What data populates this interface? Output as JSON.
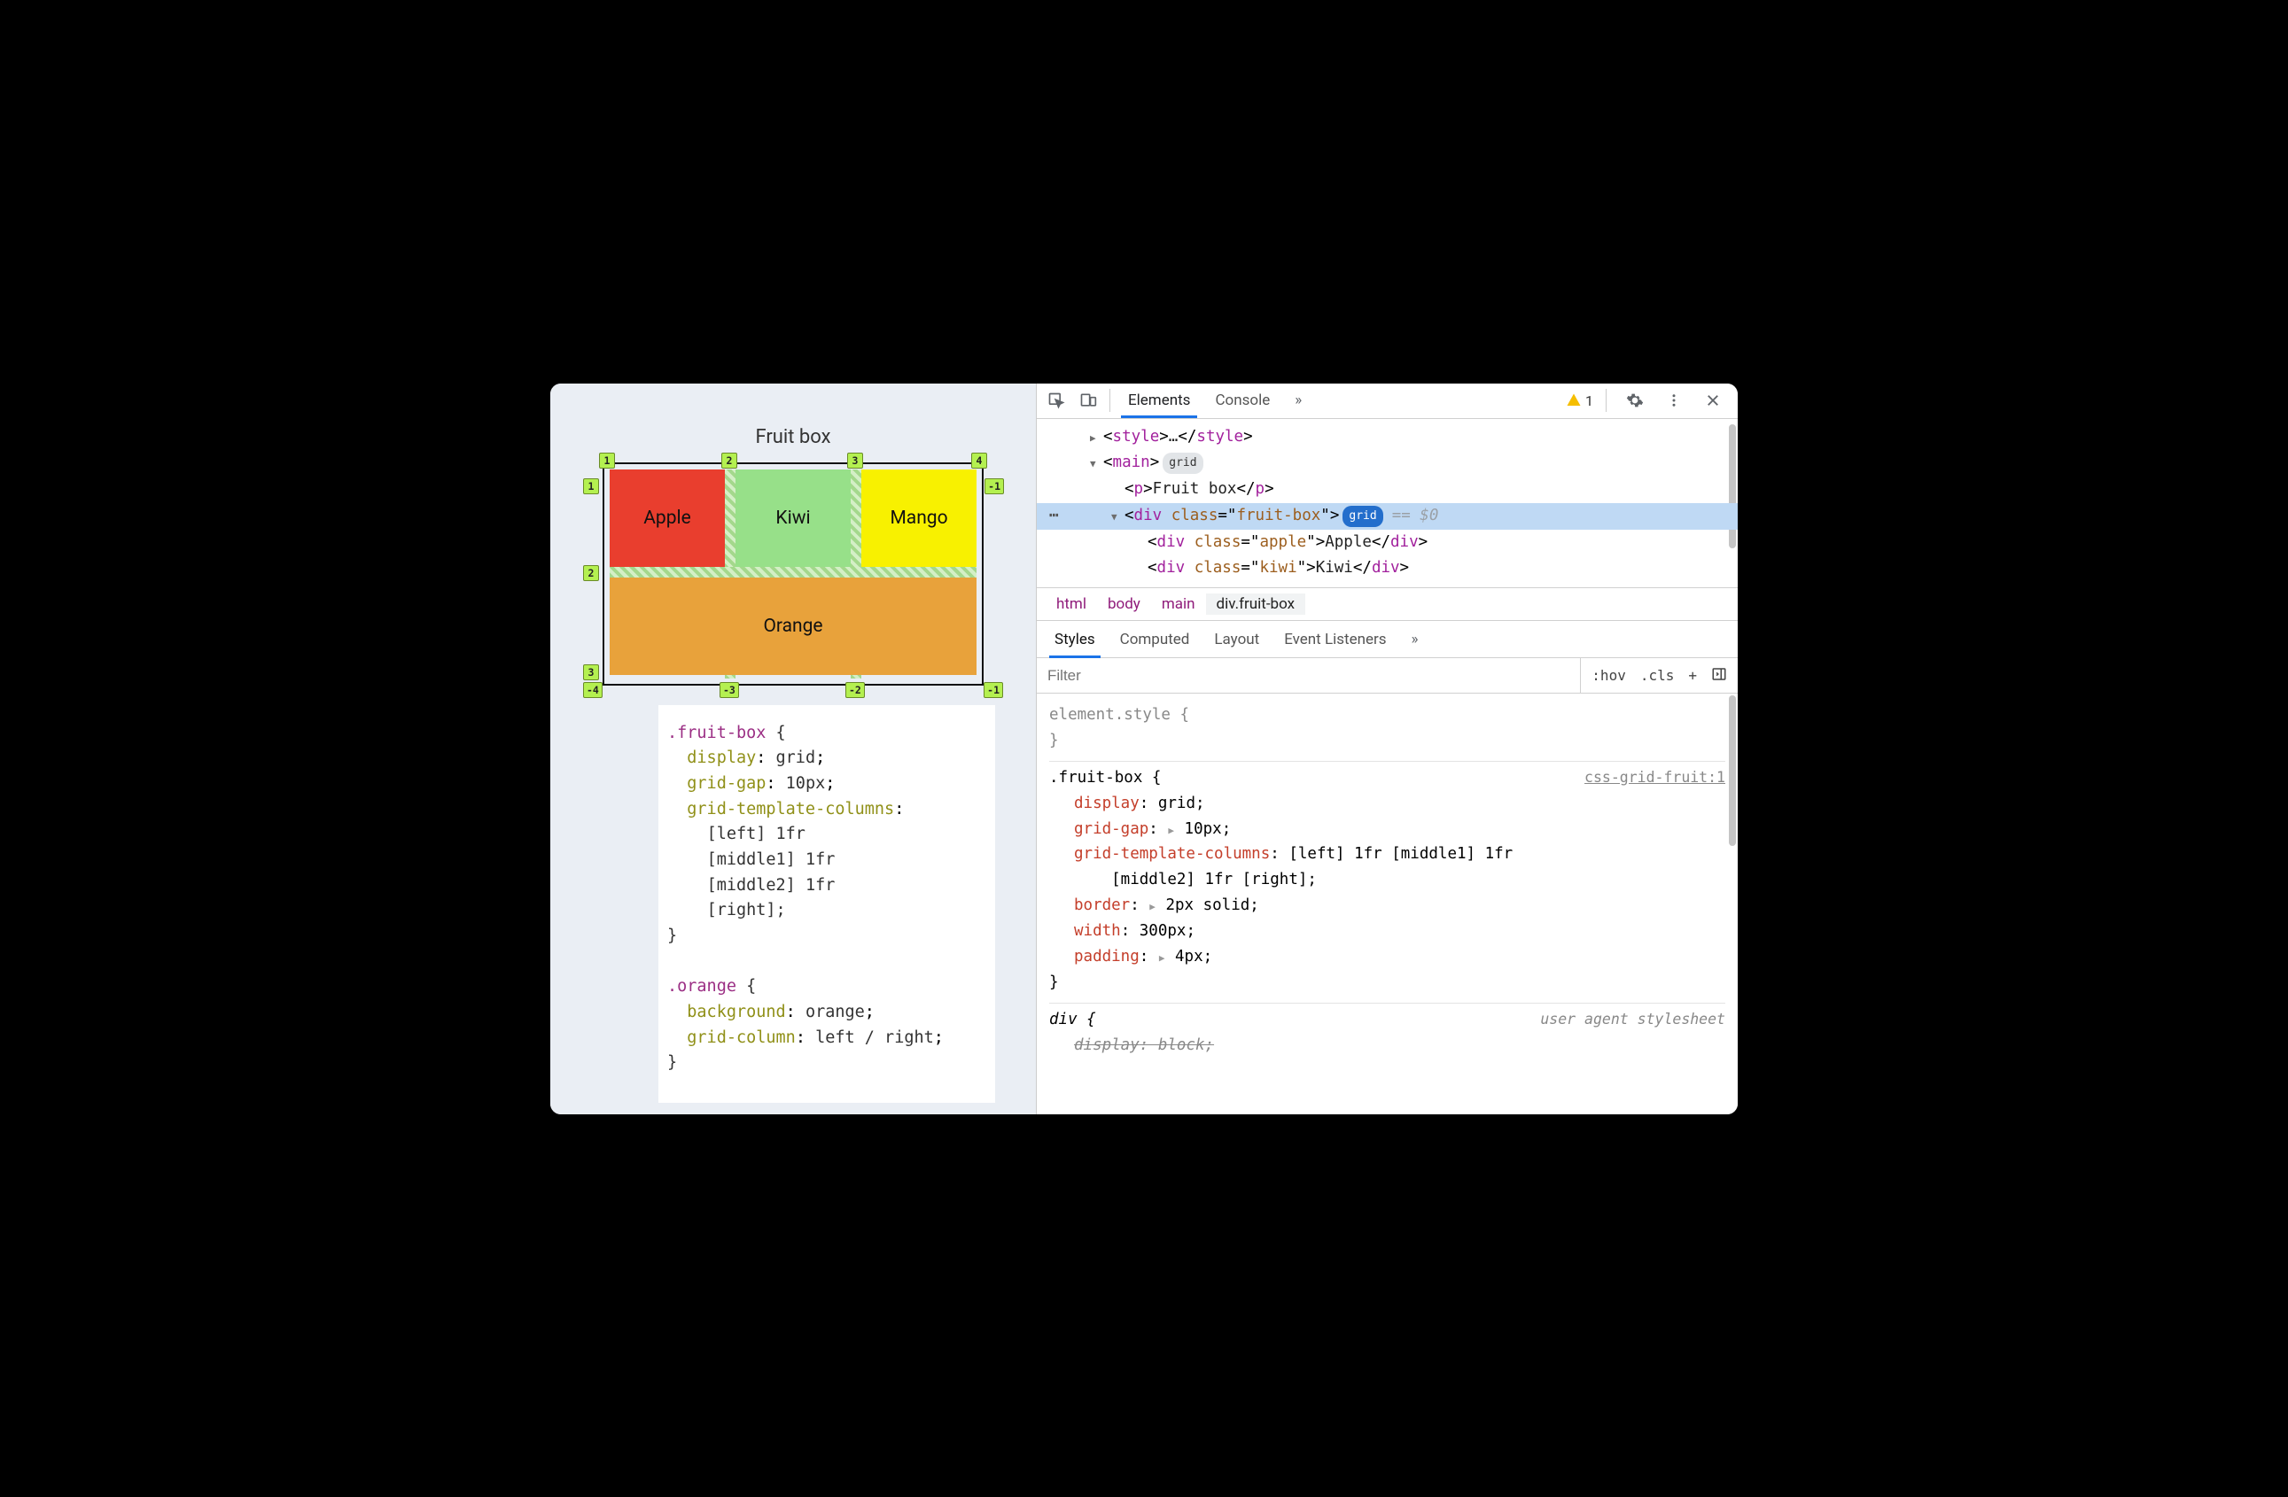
{
  "preview": {
    "title": "Fruit box",
    "cells": {
      "apple": "Apple",
      "kiwi": "Kiwi",
      "mango": "Mango",
      "orange": "Orange"
    },
    "line_labels": {
      "col_top": [
        "1",
        "2",
        "3",
        "4"
      ],
      "col_neg_top": [
        "-1"
      ],
      "row_left": [
        "1",
        "2",
        "3"
      ],
      "col_bottom": [
        "-4",
        "-3",
        "-2",
        "-1"
      ]
    },
    "code": ".fruit-box {\n  display: grid;\n  grid-gap: 10px;\n  grid-template-columns:\n    [left] 1fr\n    [middle1] 1fr\n    [middle2] 1fr\n    [right];\n}\n\n.orange {\n  background: orange;\n  grid-column: left / right;\n}"
  },
  "toolbar": {
    "tabs": [
      "Elements",
      "Console"
    ],
    "more": "»",
    "warn_count": "1"
  },
  "dom": {
    "rows": [
      {
        "indent": 1,
        "tri": "▶",
        "html_pre": "<style>",
        "html_mid": "…",
        "html_post": "</style>"
      },
      {
        "indent": 1,
        "tri": "▼",
        "html_pre": "<main>",
        "badge": "grid"
      },
      {
        "indent": 2,
        "tri": "",
        "html_pre": "<p>",
        "text": "Fruit box",
        "html_post": "</p>"
      },
      {
        "indent": 2,
        "tri": "▼",
        "selected": true,
        "html_pre": "<div class=\"fruit-box\">",
        "badge": "grid",
        "badge_blue": true,
        "eq0": "== $0"
      },
      {
        "indent": 3,
        "tri": "",
        "html_pre": "<div class=\"apple\">",
        "text": "Apple",
        "html_post": "</div>"
      },
      {
        "indent": 3,
        "tri": "",
        "html_pre": "<div class=\"kiwi\">",
        "text": "Kiwi",
        "html_post": "</div>"
      }
    ]
  },
  "breadcrumb": [
    "html",
    "body",
    "main",
    "div.fruit-box"
  ],
  "breadcrumb_active": 3,
  "styles_tabs": [
    "Styles",
    "Computed",
    "Layout",
    "Event Listeners"
  ],
  "styles_tabs_more": "»",
  "filter_placeholder": "Filter",
  "filter_tools": {
    "hov": ":hov",
    "cls": ".cls",
    "plus": "+"
  },
  "styles": {
    "element_style": {
      "selector": "element.style",
      "open": "{",
      "close": "}"
    },
    "fruit_box": {
      "selector": ".fruit-box",
      "open": "{",
      "close": "}",
      "source": "css-grid-fruit:1",
      "props": [
        {
          "name": "display",
          "value": "grid",
          "expand": false
        },
        {
          "name": "grid-gap",
          "value": "10px",
          "expand": true
        },
        {
          "name": "grid-template-columns",
          "value": "[left] 1fr [middle1] 1fr [middle2] 1fr [right]",
          "expand": false
        },
        {
          "name": "border",
          "value": "2px solid",
          "expand": true
        },
        {
          "name": "width",
          "value": "300px",
          "expand": false
        },
        {
          "name": "padding",
          "value": "4px",
          "expand": true
        }
      ]
    },
    "user_agent": {
      "selector": "div",
      "open": "{",
      "source": "user agent stylesheet",
      "props": [
        {
          "name": "display",
          "value": "block",
          "strike": true
        }
      ]
    }
  }
}
